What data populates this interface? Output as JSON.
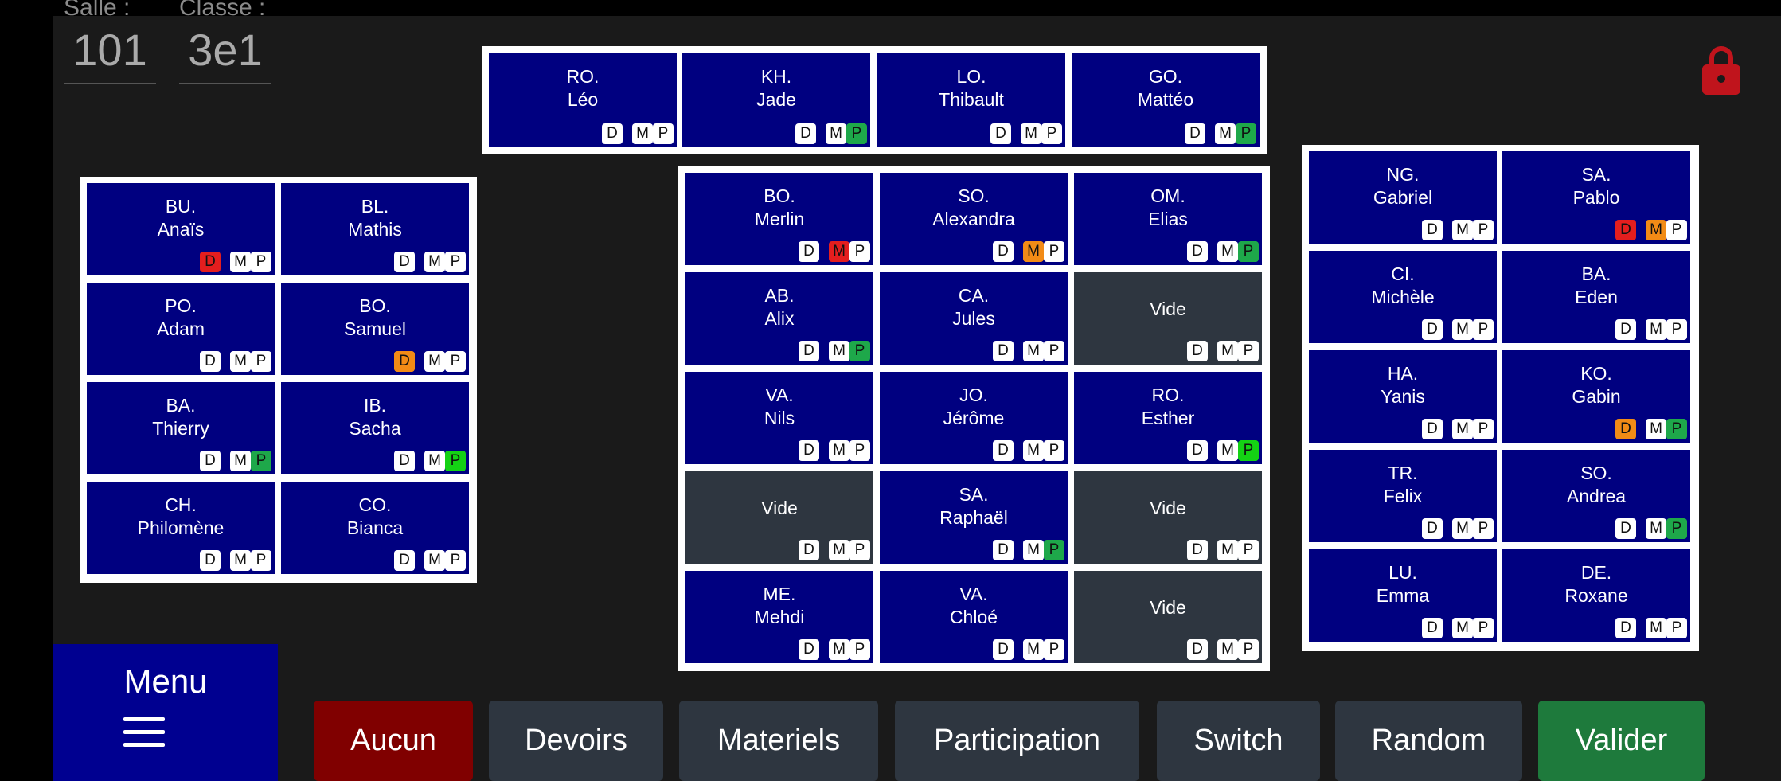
{
  "header": {
    "salle_label": "Salle :",
    "salle_value": "101",
    "classe_label": "Classe :",
    "classe_value": "3e1"
  },
  "badge_letters": [
    "D",
    "M",
    "P"
  ],
  "colors": {
    "seat": "#000080",
    "empty_seat": "#2e3640",
    "badge_red": "#e41e1e",
    "badge_orange": "#f28b16",
    "badge_green": "#1ea84a",
    "badge_lime": "#14d214",
    "lock": "#c0141c"
  },
  "icons": {
    "lock": "lock-icon",
    "menu": "hamburger-icon"
  },
  "groups": [
    {
      "id": "top-row",
      "seats": [
        {
          "line1": "RO.",
          "line2": "Léo",
          "d": "",
          "m": "",
          "p": ""
        },
        {
          "line1": "KH.",
          "line2": "Jade",
          "d": "",
          "m": "",
          "p": "green"
        },
        {
          "line1": "LO.",
          "line2": "Thibault",
          "d": "",
          "m": "",
          "p": ""
        },
        {
          "line1": "GO.",
          "line2": "Mattéo",
          "d": "",
          "m": "",
          "p": "green"
        }
      ]
    },
    {
      "id": "left-block",
      "seats": [
        {
          "line1": "BU.",
          "line2": "Anaïs",
          "d": "red",
          "m": "",
          "p": ""
        },
        {
          "line1": "BL.",
          "line2": "Mathis",
          "d": "",
          "m": "",
          "p": ""
        },
        {
          "line1": "PO.",
          "line2": "Adam",
          "d": "",
          "m": "",
          "p": ""
        },
        {
          "line1": "BO.",
          "line2": "Samuel",
          "d": "orange",
          "m": "",
          "p": ""
        },
        {
          "line1": "BA.",
          "line2": "Thierry",
          "d": "",
          "m": "",
          "p": "green"
        },
        {
          "line1": "IB.",
          "line2": "Sacha",
          "d": "",
          "m": "",
          "p": "lime"
        },
        {
          "line1": "CH.",
          "line2": "Philomène",
          "d": "",
          "m": "",
          "p": ""
        },
        {
          "line1": "CO.",
          "line2": "Bianca",
          "d": "",
          "m": "",
          "p": ""
        }
      ]
    },
    {
      "id": "center-block",
      "seats": [
        {
          "line1": "BO.",
          "line2": "Merlin",
          "d": "",
          "m": "red",
          "p": ""
        },
        {
          "line1": "SO.",
          "line2": "Alexandra",
          "d": "",
          "m": "orange",
          "p": ""
        },
        {
          "line1": "OM.",
          "line2": "Elias",
          "d": "",
          "m": "",
          "p": "green"
        },
        {
          "line1": "AB.",
          "line2": "Alix",
          "d": "",
          "m": "",
          "p": "green"
        },
        {
          "line1": "CA.",
          "line2": "Jules",
          "d": "",
          "m": "",
          "p": ""
        },
        {
          "empty": true,
          "label": "Vide",
          "d": "",
          "m": "",
          "p": ""
        },
        {
          "line1": "VA.",
          "line2": "Nils",
          "d": "",
          "m": "",
          "p": ""
        },
        {
          "line1": "JO.",
          "line2": "Jérôme",
          "d": "",
          "m": "",
          "p": ""
        },
        {
          "line1": "RO.",
          "line2": "Esther",
          "d": "",
          "m": "",
          "p": "lime"
        },
        {
          "empty": true,
          "label": "Vide",
          "d": "",
          "m": "",
          "p": ""
        },
        {
          "line1": "SA.",
          "line2": "Raphaël",
          "d": "",
          "m": "",
          "p": "green"
        },
        {
          "empty": true,
          "label": "Vide",
          "d": "",
          "m": "",
          "p": ""
        },
        {
          "line1": "ME.",
          "line2": "Mehdi",
          "d": "",
          "m": "",
          "p": ""
        },
        {
          "line1": "VA.",
          "line2": "Chloé",
          "d": "",
          "m": "",
          "p": ""
        },
        {
          "empty": true,
          "label": "Vide",
          "d": "",
          "m": "",
          "p": ""
        }
      ]
    },
    {
      "id": "right-block",
      "seats": [
        {
          "line1": "NG.",
          "line2": "Gabriel",
          "d": "",
          "m": "",
          "p": ""
        },
        {
          "line1": "SA.",
          "line2": "Pablo",
          "d": "red",
          "m": "orange",
          "p": ""
        },
        {
          "line1": "CI.",
          "line2": "Michèle",
          "d": "",
          "m": "",
          "p": ""
        },
        {
          "line1": "BA.",
          "line2": "Eden",
          "d": "",
          "m": "",
          "p": ""
        },
        {
          "line1": "HA.",
          "line2": "Yanis",
          "d": "",
          "m": "",
          "p": ""
        },
        {
          "line1": "KO.",
          "line2": "Gabin",
          "d": "orange",
          "m": "",
          "p": "green"
        },
        {
          "line1": "TR.",
          "line2": "Felix",
          "d": "",
          "m": "",
          "p": ""
        },
        {
          "line1": "SO.",
          "line2": "Andrea",
          "d": "",
          "m": "",
          "p": "green"
        },
        {
          "line1": "LU.",
          "line2": "Emma",
          "d": "",
          "m": "",
          "p": ""
        },
        {
          "line1": "DE.",
          "line2": "Roxane",
          "d": "",
          "m": "",
          "p": ""
        }
      ]
    }
  ],
  "menu": {
    "label": "Menu"
  },
  "actions": [
    {
      "label": "Aucun",
      "style": "red"
    },
    {
      "label": "Devoirs",
      "style": ""
    },
    {
      "label": "Materiels",
      "style": ""
    },
    {
      "label": "Participation",
      "style": ""
    },
    {
      "label": "Switch",
      "style": ""
    },
    {
      "label": "Random",
      "style": ""
    },
    {
      "label": "Valider",
      "style": "green"
    }
  ]
}
